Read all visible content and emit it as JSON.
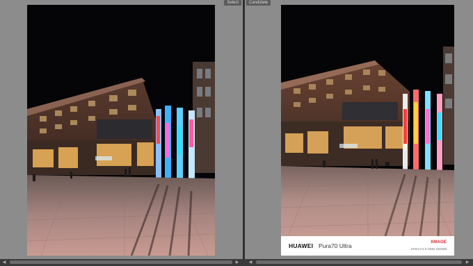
{
  "panes": {
    "left": {
      "tag": "Select"
    },
    "right": {
      "tag": "Candidate"
    }
  },
  "watermark": {
    "brand": "HUAWEI",
    "model": "Pura70 Ultra",
    "badge": "XMAGE",
    "params": "27mm  F1.6  1/50s  ISO208"
  },
  "colors": {
    "pane_background": "#8c8c8c",
    "divider": "#2f2f2f",
    "sky": "#050508",
    "badge_red": "#d4232a"
  },
  "icons": {
    "scroll_left": "triangle-left-icon",
    "scroll_right": "triangle-right-icon"
  }
}
